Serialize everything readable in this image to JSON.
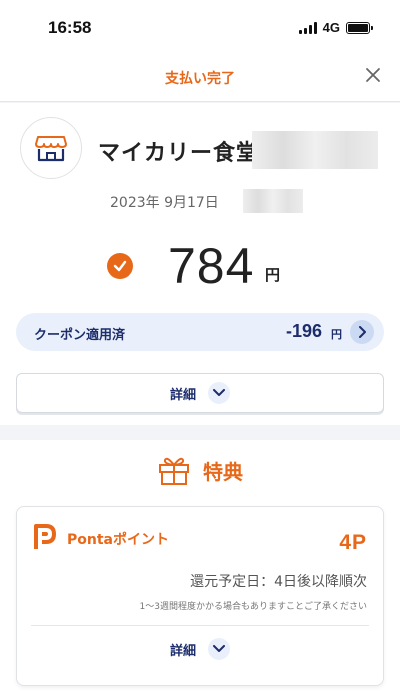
{
  "status_bar": {
    "time": "16:58",
    "network": "4G"
  },
  "header": {
    "title": "支払い完了"
  },
  "payment": {
    "store_name": "マイカリー食堂",
    "date": "2023年 9月17日",
    "amount": "784",
    "amount_unit": "円"
  },
  "coupon": {
    "label": "クーポン適用済",
    "value": "-196",
    "unit": "円"
  },
  "detail": {
    "label": "詳細"
  },
  "benefit": {
    "title": "特典",
    "ponta": {
      "name": "Pontaポイント",
      "points": "4P",
      "return_date": "還元予定日：4日後以降順次",
      "note": "1〜3週間程度かかる場合もありますことご了承ください",
      "detail_label": "詳細"
    }
  },
  "colors": {
    "accent": "#e8681a",
    "navy": "#1d2d6b",
    "light_blue": "#e9f0fb"
  }
}
